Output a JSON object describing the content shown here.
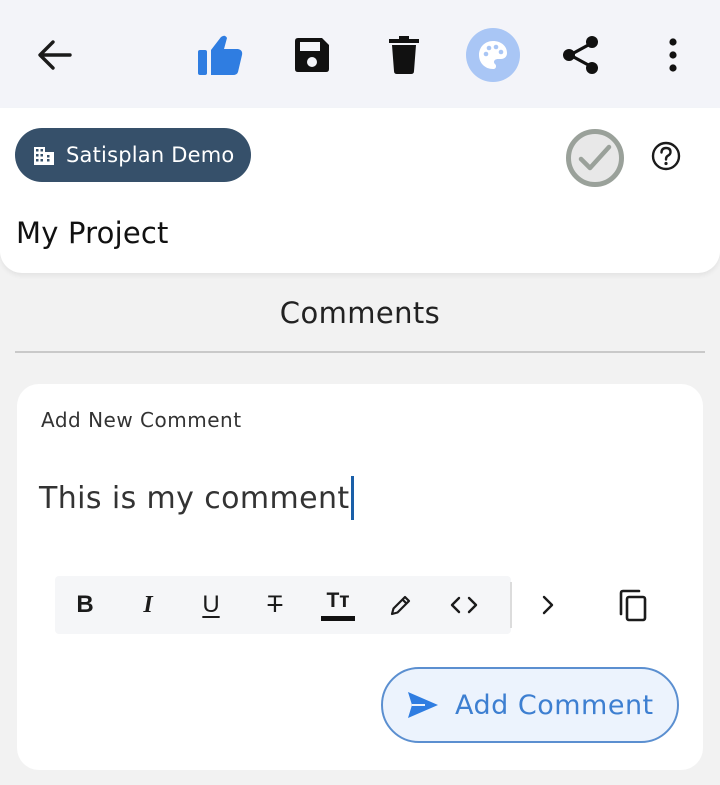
{
  "toolbar": {
    "icons": [
      "back-arrow-icon",
      "thumbs-up-icon",
      "save-icon",
      "delete-icon",
      "palette-icon",
      "share-icon",
      "more-vert-icon"
    ]
  },
  "header": {
    "org_chip": "Satisplan Demo",
    "project_title": "My Project"
  },
  "section": {
    "title": "Comments"
  },
  "comment_form": {
    "label": "Add New Comment",
    "value": "This is my comment",
    "formatting": {
      "bold": "B",
      "italic": "I",
      "underline": "U",
      "strikethrough": "T",
      "text_size": "Tт"
    },
    "submit_label": "Add Comment"
  },
  "colors": {
    "accent_blue": "#2f7de1",
    "chip_bg": "#36506a",
    "button_text": "#3d7fd1"
  }
}
